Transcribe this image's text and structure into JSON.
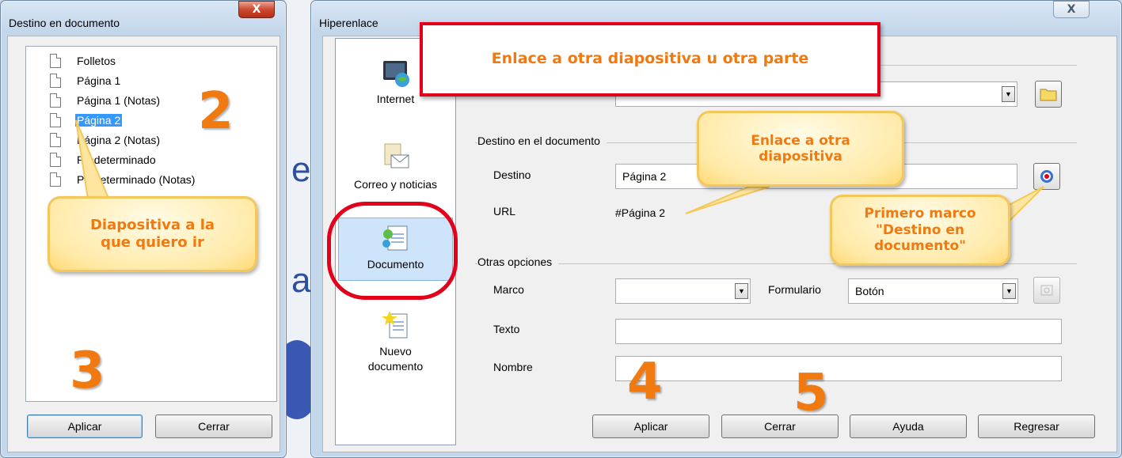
{
  "left_dialog": {
    "title": "Destino en documento",
    "close_label": "X",
    "items": [
      {
        "label": "Folletos"
      },
      {
        "label": "Página 1"
      },
      {
        "label": "Página 1 (Notas)"
      },
      {
        "label": "Página 2",
        "selected": true
      },
      {
        "label": "Página 2 (Notas)"
      },
      {
        "label": "Predeterminado"
      },
      {
        "label": "Predeterminado (Notas)"
      }
    ],
    "apply_label": "Aplicar",
    "close_button_label": "Cerrar"
  },
  "right_dialog": {
    "title": "Hiperenlace",
    "close_label": "X",
    "categories": [
      {
        "label": "Internet",
        "icon": "globe-icon"
      },
      {
        "label": "Correo y noticias",
        "icon": "mail-icon"
      },
      {
        "label": "Documento",
        "icon": "document-icon",
        "active": true
      },
      {
        "label": "Nuevo documento",
        "icon": "new-document-icon"
      }
    ],
    "target_section_title": "Destino en el documento",
    "target_label": "Destino",
    "target_value": "Página 2",
    "url_label": "URL",
    "url_value": "#Página 2",
    "other_options_title": "Otras opciones",
    "frame_label": "Marco",
    "frame_value": "",
    "form_label": "Formulario",
    "form_value": "Botón",
    "text_label": "Texto",
    "text_value": "",
    "name_label": "Nombre",
    "name_value": "",
    "buttons": {
      "apply": "Aplicar",
      "close": "Cerrar",
      "help": "Ayuda",
      "back": "Regresar"
    }
  },
  "annotations": {
    "banner": "Enlace a otra diapositiva u otra parte",
    "callout_slide_line1": "Enlace a otra",
    "callout_slide_line2": "diapositiva",
    "callout_first_line1": "Primero marco",
    "callout_first_line2": "\"Destino en",
    "callout_first_line3": "documento\"",
    "callout_target_line1": "Diapositiva a la",
    "callout_target_line2": "que quiero ir",
    "step2": "2",
    "step3": "3",
    "step4": "4",
    "step5": "5"
  },
  "colors": {
    "accent_orange": "#f07a10",
    "annotation_red": "#e3001b",
    "selection_blue": "#3399ff"
  }
}
